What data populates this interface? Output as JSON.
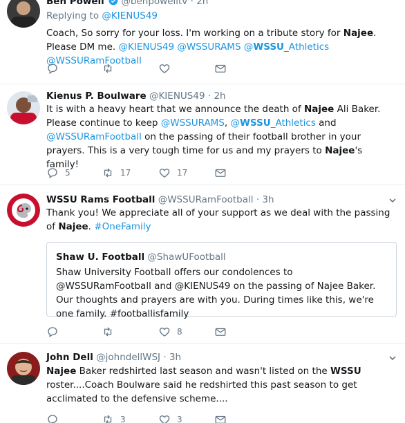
{
  "tweets": [
    {
      "name": "Ben Powell",
      "handle": "@benpowelltv",
      "time": "2h",
      "replying_prefix": "Replying to ",
      "replying_handle": "@KIENUS49",
      "text": {
        "p1": "Coach, So sorry for your loss. I'm working on a tribute story for ",
        "b1": "Najee",
        "p2": ". Please DM me. ",
        "l1": "@KIENUS49",
        "l2": "@WSSURAMS",
        "l3a": "@",
        "l3b": "WSSU",
        "l3c": "_Athletics",
        "l4": "@WSSURamFootball"
      },
      "actions": {
        "reply": "",
        "retweet": "",
        "like": ""
      }
    },
    {
      "name": "Kienus P. Boulware",
      "handle": "@KIENUS49",
      "time": "2h",
      "text": {
        "p1": "It is with a heavy heart that we announce the death of ",
        "b1": "Najee",
        "p2": " Ali Baker. Please continue to keep ",
        "l1": "@WSSURAMS",
        "p3": ", ",
        "l2a": "@",
        "l2b": "WSSU",
        "l2c": "_Athletics",
        "p4": " and ",
        "l3": "@WSSURamFootball",
        "p5": " on the passing of their football brother in your prayers. This is a very tough time for us and my prayers to ",
        "b2": "Najee",
        "p6": "'s family!"
      },
      "actions": {
        "reply": "5",
        "retweet": "17",
        "like": "17"
      }
    },
    {
      "name": "WSSU Rams Football",
      "handle": "@WSSURamFootball",
      "time": "3h",
      "text": {
        "p1": "Thank you! We appreciate all of your support as we deal with the passing of ",
        "b1": "Najee",
        "p2": ". ",
        "l1": "#OneFamily"
      },
      "quote": {
        "name": "Shaw U. Football",
        "handle": "@ShawUFootball",
        "text": "Shaw University Football offers our condolences to @WSSURamFootball and @KIENUS49 on the passing of Najee Baker. Our thoughts and prayers are with you. During times like this, we're one family. #footballisfamily"
      },
      "actions": {
        "reply": "",
        "retweet": "",
        "like": "8"
      }
    },
    {
      "name": "John Dell",
      "handle": "@johndellWSJ",
      "time": "3h",
      "text": {
        "b1": "Najee",
        "p1": " Baker redshirted last season and wasn't listed on the ",
        "b2": "WSSU",
        "p2": " roster....Coach Boulware said he redshirted this past season to get acclimated to the defensive scheme...."
      },
      "actions": {
        "reply": "",
        "retweet": "3",
        "like": "3"
      }
    }
  ],
  "sep": "·",
  "colors": {
    "link": "#1b95e0",
    "muted": "#657786",
    "verified": "#1da1f2",
    "border": "#e6ecf0"
  },
  "icons": [
    "reply-icon",
    "retweet-icon",
    "like-icon",
    "dm-icon",
    "verified-icon",
    "caret-down-icon"
  ]
}
